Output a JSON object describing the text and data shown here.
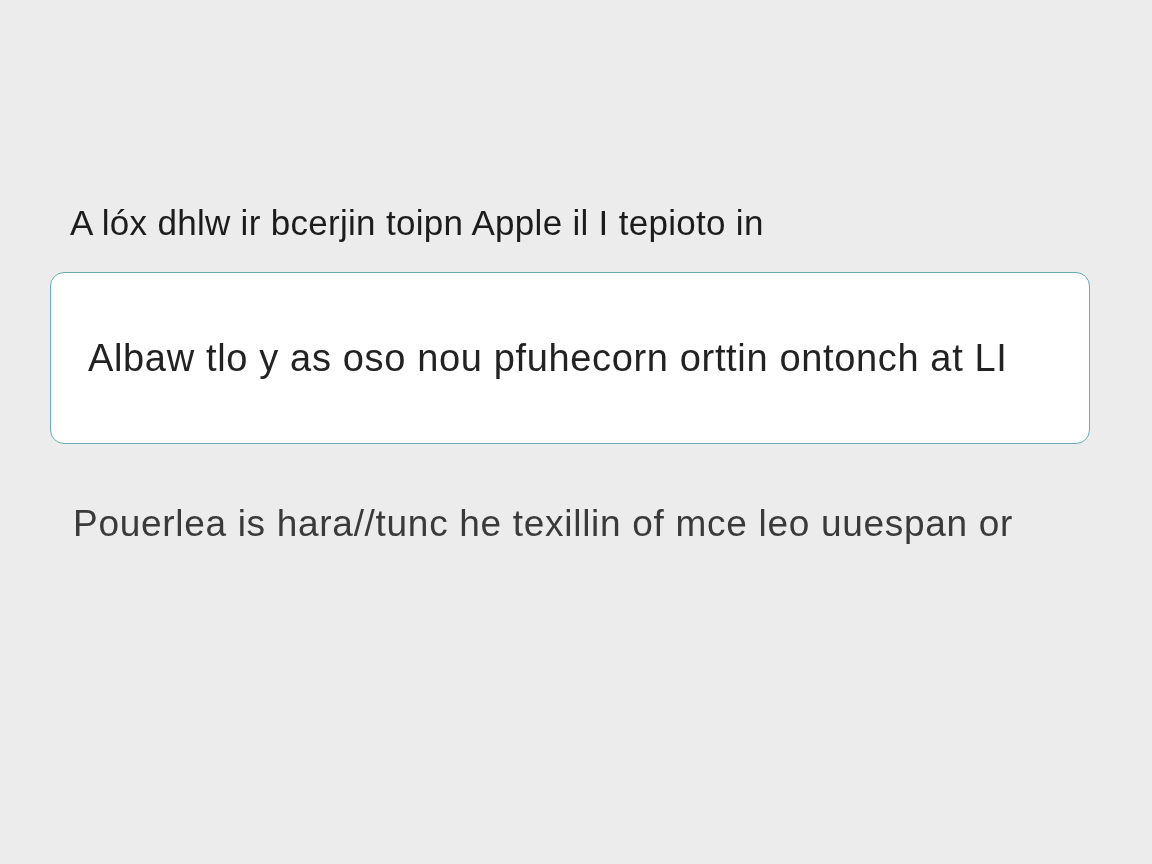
{
  "label": "A lóx dhlw ir bcerjin toipn Apple il I tepioto in",
  "field": {
    "value": "Albaw tlo y as oso nou pfuhecorn orttin ontonch at LI"
  },
  "helper_text": "Pouerlea is hara//tunc he texillin of mce leo uuespan or"
}
